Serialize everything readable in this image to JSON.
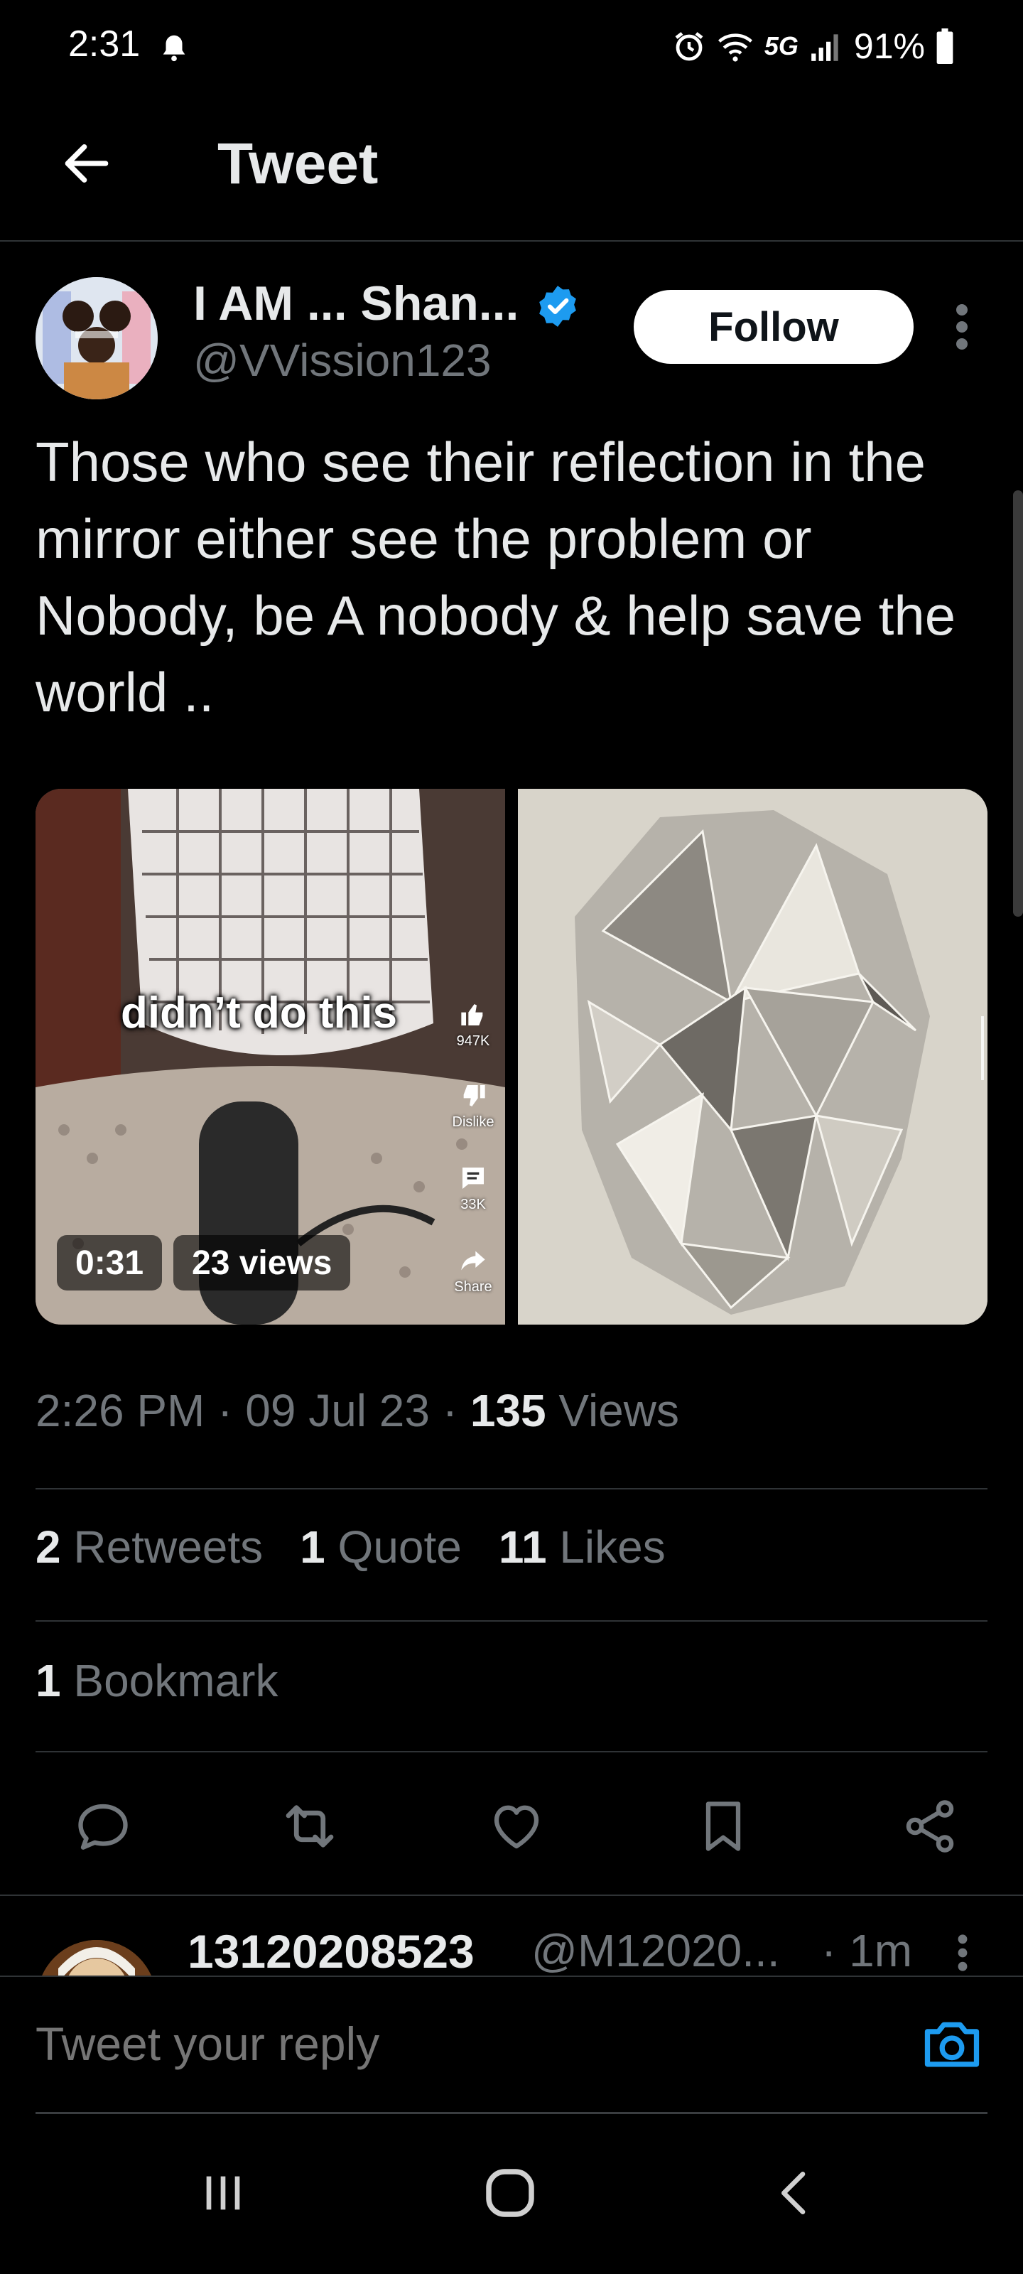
{
  "status_bar": {
    "time": "2:31",
    "network": "5G",
    "battery": "91%"
  },
  "header": {
    "title": "Tweet"
  },
  "tweet": {
    "author_name": "I AM ... Shan...",
    "handle": "@VVission123",
    "follow_label": "Follow",
    "text": "Those who see their reflection in the mirror either see the problem or Nobody, be A nobody & help save the world ..",
    "media": {
      "video_caption": "didn’t do this",
      "like_count": "947K",
      "dislike_label": "Dislike",
      "comment_count": "33K",
      "share_label": "Share",
      "duration": "0:31",
      "views_badge": "23 views"
    },
    "time": "2:26 PM",
    "date": "09 Jul 23",
    "views_count": "135",
    "views_label": "Views",
    "retweets_count": "2",
    "retweets_label": "Retweets",
    "quotes_count": "1",
    "quotes_label": "Quote",
    "likes_count": "11",
    "likes_label": "Likes",
    "bookmarks_count": "1",
    "bookmarks_label": "Bookmark"
  },
  "reply": {
    "name": "13120208523",
    "handle": "@M12020...",
    "time": "· 1m"
  },
  "compose": {
    "placeholder": "Tweet your reply"
  },
  "colors": {
    "background": "#000000",
    "text": "#e7e9ea",
    "muted": "#71767b",
    "accent": "#1d9bf0",
    "divider": "#2f3336"
  }
}
